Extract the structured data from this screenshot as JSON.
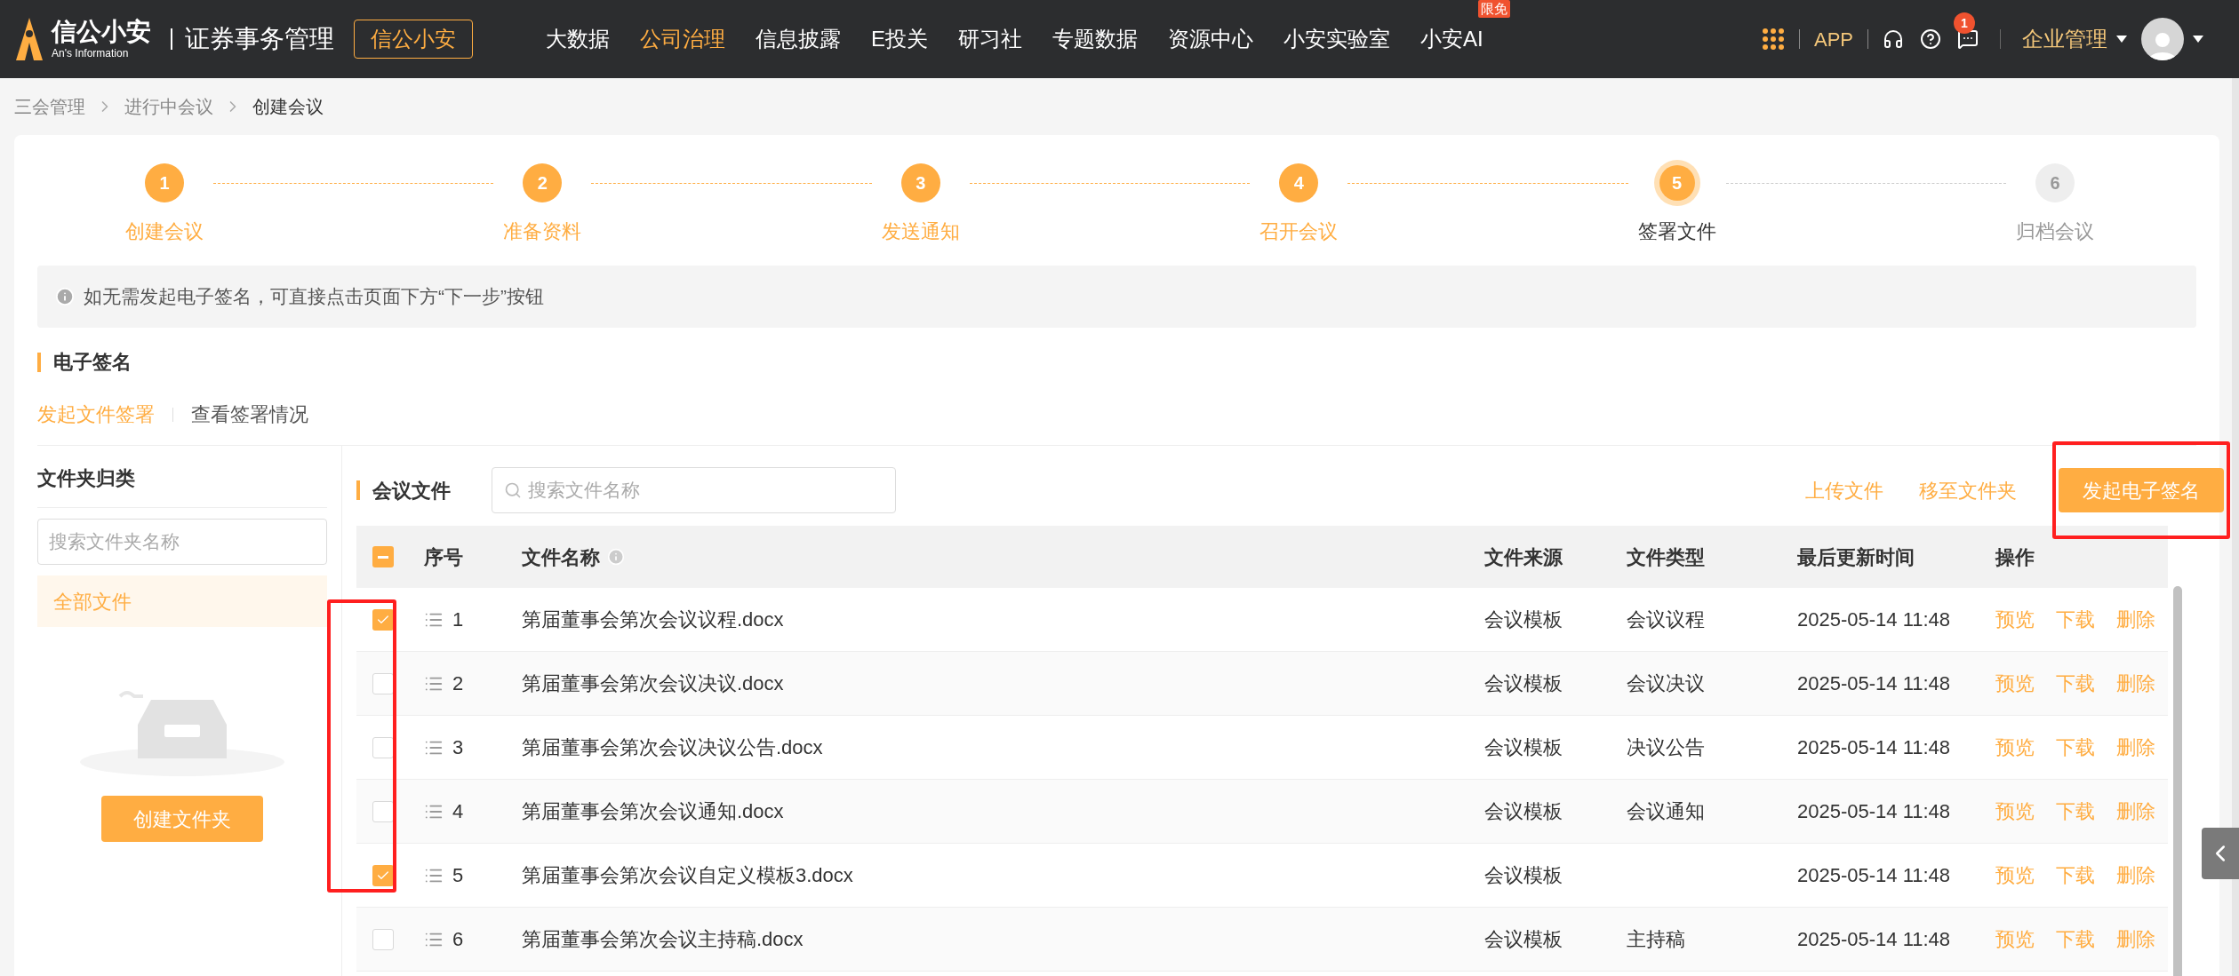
{
  "header": {
    "logo_name": "信公小安",
    "logo_sub": "An's Information",
    "product": "证券事务管理",
    "product_button": "信公小安",
    "nav": [
      {
        "label": "大数据",
        "selected": false
      },
      {
        "label": "公司治理",
        "selected": true
      },
      {
        "label": "信息披露",
        "selected": false
      },
      {
        "label": "E投关",
        "selected": false
      },
      {
        "label": "研习社",
        "selected": false
      },
      {
        "label": "专题数据",
        "selected": false
      },
      {
        "label": "资源中心",
        "selected": false
      },
      {
        "label": "小安实验室",
        "selected": false
      },
      {
        "label": "小安AI",
        "selected": false,
        "badge": "限免"
      }
    ],
    "app": "APP",
    "message_count": "1",
    "enterprise": "企业管理"
  },
  "breadcrumb": [
    "三会管理",
    "进行中会议",
    "创建会议"
  ],
  "steps": [
    {
      "number": "1",
      "label": "创建会议",
      "completed": true,
      "selected": false
    },
    {
      "number": "2",
      "label": "准备资料",
      "completed": true,
      "selected": false
    },
    {
      "number": "3",
      "label": "发送通知",
      "completed": true,
      "selected": false
    },
    {
      "number": "4",
      "label": "召开会议",
      "completed": true,
      "selected": false
    },
    {
      "number": "5",
      "label": "签署文件",
      "completed": false,
      "selected": true
    },
    {
      "number": "6",
      "label": "归档会议",
      "completed": false,
      "selected": false
    }
  ],
  "notice": "如无需发起电子签名，可直接点击页面下方“下一步”按钮",
  "section_title": "电子签名",
  "subtabs": [
    {
      "label": "发起文件签署",
      "selected": true
    },
    {
      "label": "查看签署情况",
      "selected": false
    }
  ],
  "folders": {
    "title": "文件夹归类",
    "search_placeholder": "搜索文件夹名称",
    "items": [
      {
        "label": "全部文件",
        "selected": true
      }
    ],
    "create_button": "创建文件夹"
  },
  "files": {
    "title": "会议文件",
    "search_placeholder": "搜索文件名称",
    "links": [
      "上传文件",
      "移至文件夹"
    ],
    "primary_button": "发起电子签名",
    "select_all": {
      "indeterminate": true
    },
    "columns": [
      "序号",
      "文件名称",
      "文件来源",
      "文件类型",
      "最后更新时间",
      "操作"
    ],
    "rows": [
      {
        "checked": true,
        "index": "1",
        "name": "第届董事会第次会议议程.docx",
        "source": "会议模板",
        "type": "会议议程",
        "updated": "2025-05-14 11:48",
        "actions": [
          "预览",
          "下载",
          "删除"
        ]
      },
      {
        "checked": false,
        "index": "2",
        "name": "第届董事会第次会议决议.docx",
        "source": "会议模板",
        "type": "会议决议",
        "updated": "2025-05-14 11:48",
        "actions": [
          "预览",
          "下载",
          "删除"
        ]
      },
      {
        "checked": false,
        "index": "3",
        "name": "第届董事会第次会议决议公告.docx",
        "source": "会议模板",
        "type": "决议公告",
        "updated": "2025-05-14 11:48",
        "actions": [
          "预览",
          "下载",
          "删除"
        ]
      },
      {
        "checked": false,
        "index": "4",
        "name": "第届董事会第次会议通知.docx",
        "source": "会议模板",
        "type": "会议通知",
        "updated": "2025-05-14 11:48",
        "actions": [
          "预览",
          "下载",
          "删除"
        ]
      },
      {
        "checked": true,
        "index": "5",
        "name": "第届董事会第次会议自定义模板3.docx",
        "source": "会议模板",
        "updated": "2025-05-14 11:48",
        "actions": [
          "预览",
          "下载",
          "删除"
        ]
      },
      {
        "checked": false,
        "index": "6",
        "name": "第届董事会第次会议主持稿.docx",
        "source": "会议模板",
        "type": "主持稿",
        "updated": "2025-05-14 11:48",
        "actions": [
          "预览",
          "下载",
          "删除"
        ]
      }
    ]
  }
}
